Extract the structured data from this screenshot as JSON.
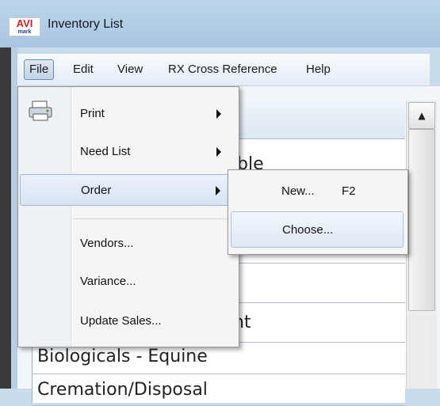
{
  "window": {
    "title": "Inventory List",
    "logo_text": "AVI",
    "logo_subtext": "mark"
  },
  "menubar": [
    {
      "label": "File",
      "active": true
    },
    {
      "label": "Edit"
    },
    {
      "label": "View"
    },
    {
      "label": "RX Cross Reference"
    },
    {
      "label": "Help"
    }
  ],
  "file_menu": {
    "items": [
      {
        "label": "Print",
        "icon": "printer-icon",
        "has_submenu": true
      },
      {
        "label": "Need List",
        "has_submenu": true
      },
      {
        "label": "Order",
        "has_submenu": true,
        "highlighted": true
      },
      {
        "label": "Vendors..."
      },
      {
        "label": "Variance..."
      },
      {
        "label": "Update Sales..."
      }
    ]
  },
  "order_submenu": {
    "items": [
      {
        "label": "New...",
        "shortcut": "F2"
      },
      {
        "label": "Choose...",
        "highlighted": true
      }
    ]
  },
  "list": {
    "rows": [
      {
        "label": "ble"
      },
      {
        "label": "ment"
      },
      {
        "label": "Biologicals - Equine"
      },
      {
        "label": "Cremation/Disposal"
      }
    ]
  },
  "colors": {
    "menu_highlight_border": "#9fb5d3",
    "window_frame": "#b7cee3"
  }
}
